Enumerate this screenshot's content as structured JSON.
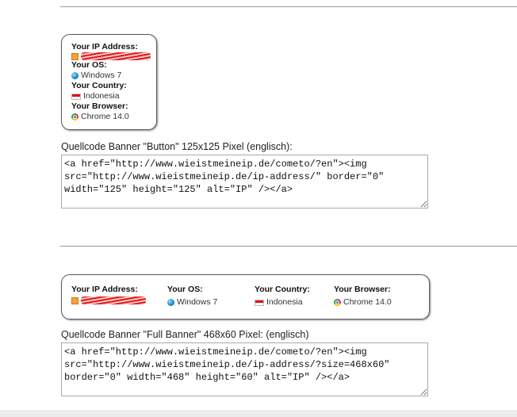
{
  "button_banner": {
    "ip_label": "Your IP Address:",
    "os_label": "Your OS:",
    "os_value": "Windows 7",
    "country_label": "Your Country:",
    "country_value": "Indonesia",
    "browser_label": "Your Browser:",
    "browser_value": "Chrome 14.0"
  },
  "button_caption": "Quellcode Banner \"Button\" 125x125 Pixel (englisch):",
  "button_code": "<a href=\"http://www.wieistmeineip.de/cometo/?en\"><img src=\"http://www.wieistmeineip.de/ip-address/\" border=\"0\" width=\"125\" height=\"125\" alt=\"IP\" /></a>",
  "full_banner": {
    "ip_label": "Your IP Address:",
    "os_label": "Your OS:",
    "os_value": "Windows 7",
    "country_label": "Your Country:",
    "country_value": "Indonesia",
    "browser_label": "Your Browser:",
    "browser_value": "Chrome 14.0"
  },
  "full_caption": "Quellcode Banner \"Full Banner\" 468x60 Pixel: (englisch)",
  "full_code": "<a href=\"http://www.wieistmeineip.de/cometo/?en\"><img src=\"http://www.wieistmeineip.de/ip-address/?size=468x60\" border=\"0\" width=\"468\" height=\"60\" alt=\"IP\" /></a>",
  "icons": {
    "ip": "ip-address-icon",
    "os": "windows-logo-icon",
    "country": "indonesia-flag-icon",
    "browser": "chrome-logo-icon"
  },
  "colors": {
    "redaction": "#e21b1b",
    "border": "#5a5a5a"
  }
}
